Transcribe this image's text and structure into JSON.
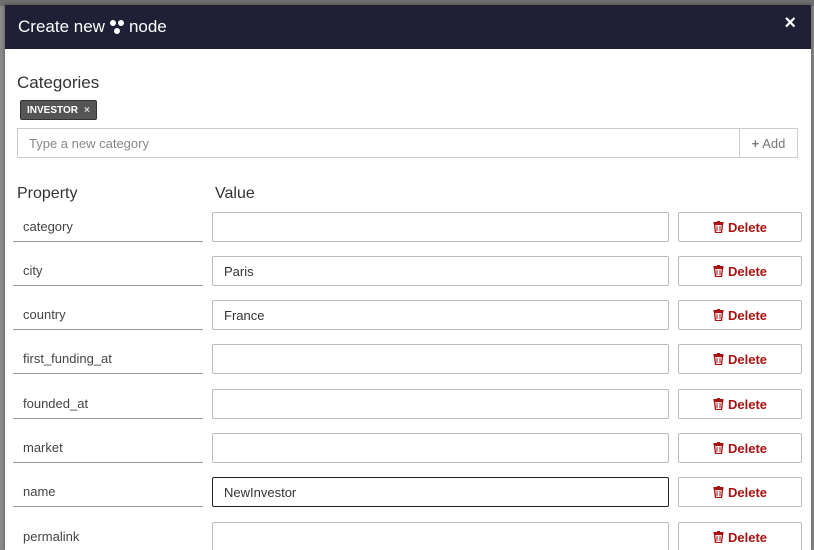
{
  "dialog": {
    "title_before": "Create new",
    "title_after": "node",
    "close_label": "×"
  },
  "categories": {
    "label": "Categories",
    "items": [
      {
        "label": "INVESTOR",
        "remove_label": "×"
      }
    ],
    "input_placeholder": "Type a new category",
    "add_label": "Add"
  },
  "properties": {
    "header_property": "Property",
    "header_value": "Value",
    "delete_label": "Delete",
    "rows": [
      {
        "name": "category",
        "value": ""
      },
      {
        "name": "city",
        "value": "Paris"
      },
      {
        "name": "country",
        "value": "France"
      },
      {
        "name": "first_funding_at",
        "value": ""
      },
      {
        "name": "founded_at",
        "value": ""
      },
      {
        "name": "market",
        "value": ""
      },
      {
        "name": "name",
        "value": "NewInvestor"
      },
      {
        "name": "permalink",
        "value": ""
      }
    ]
  },
  "colors": {
    "header_bg": "#1f1f35",
    "delete_text": "#a81212",
    "chip_bg": "#555555"
  }
}
